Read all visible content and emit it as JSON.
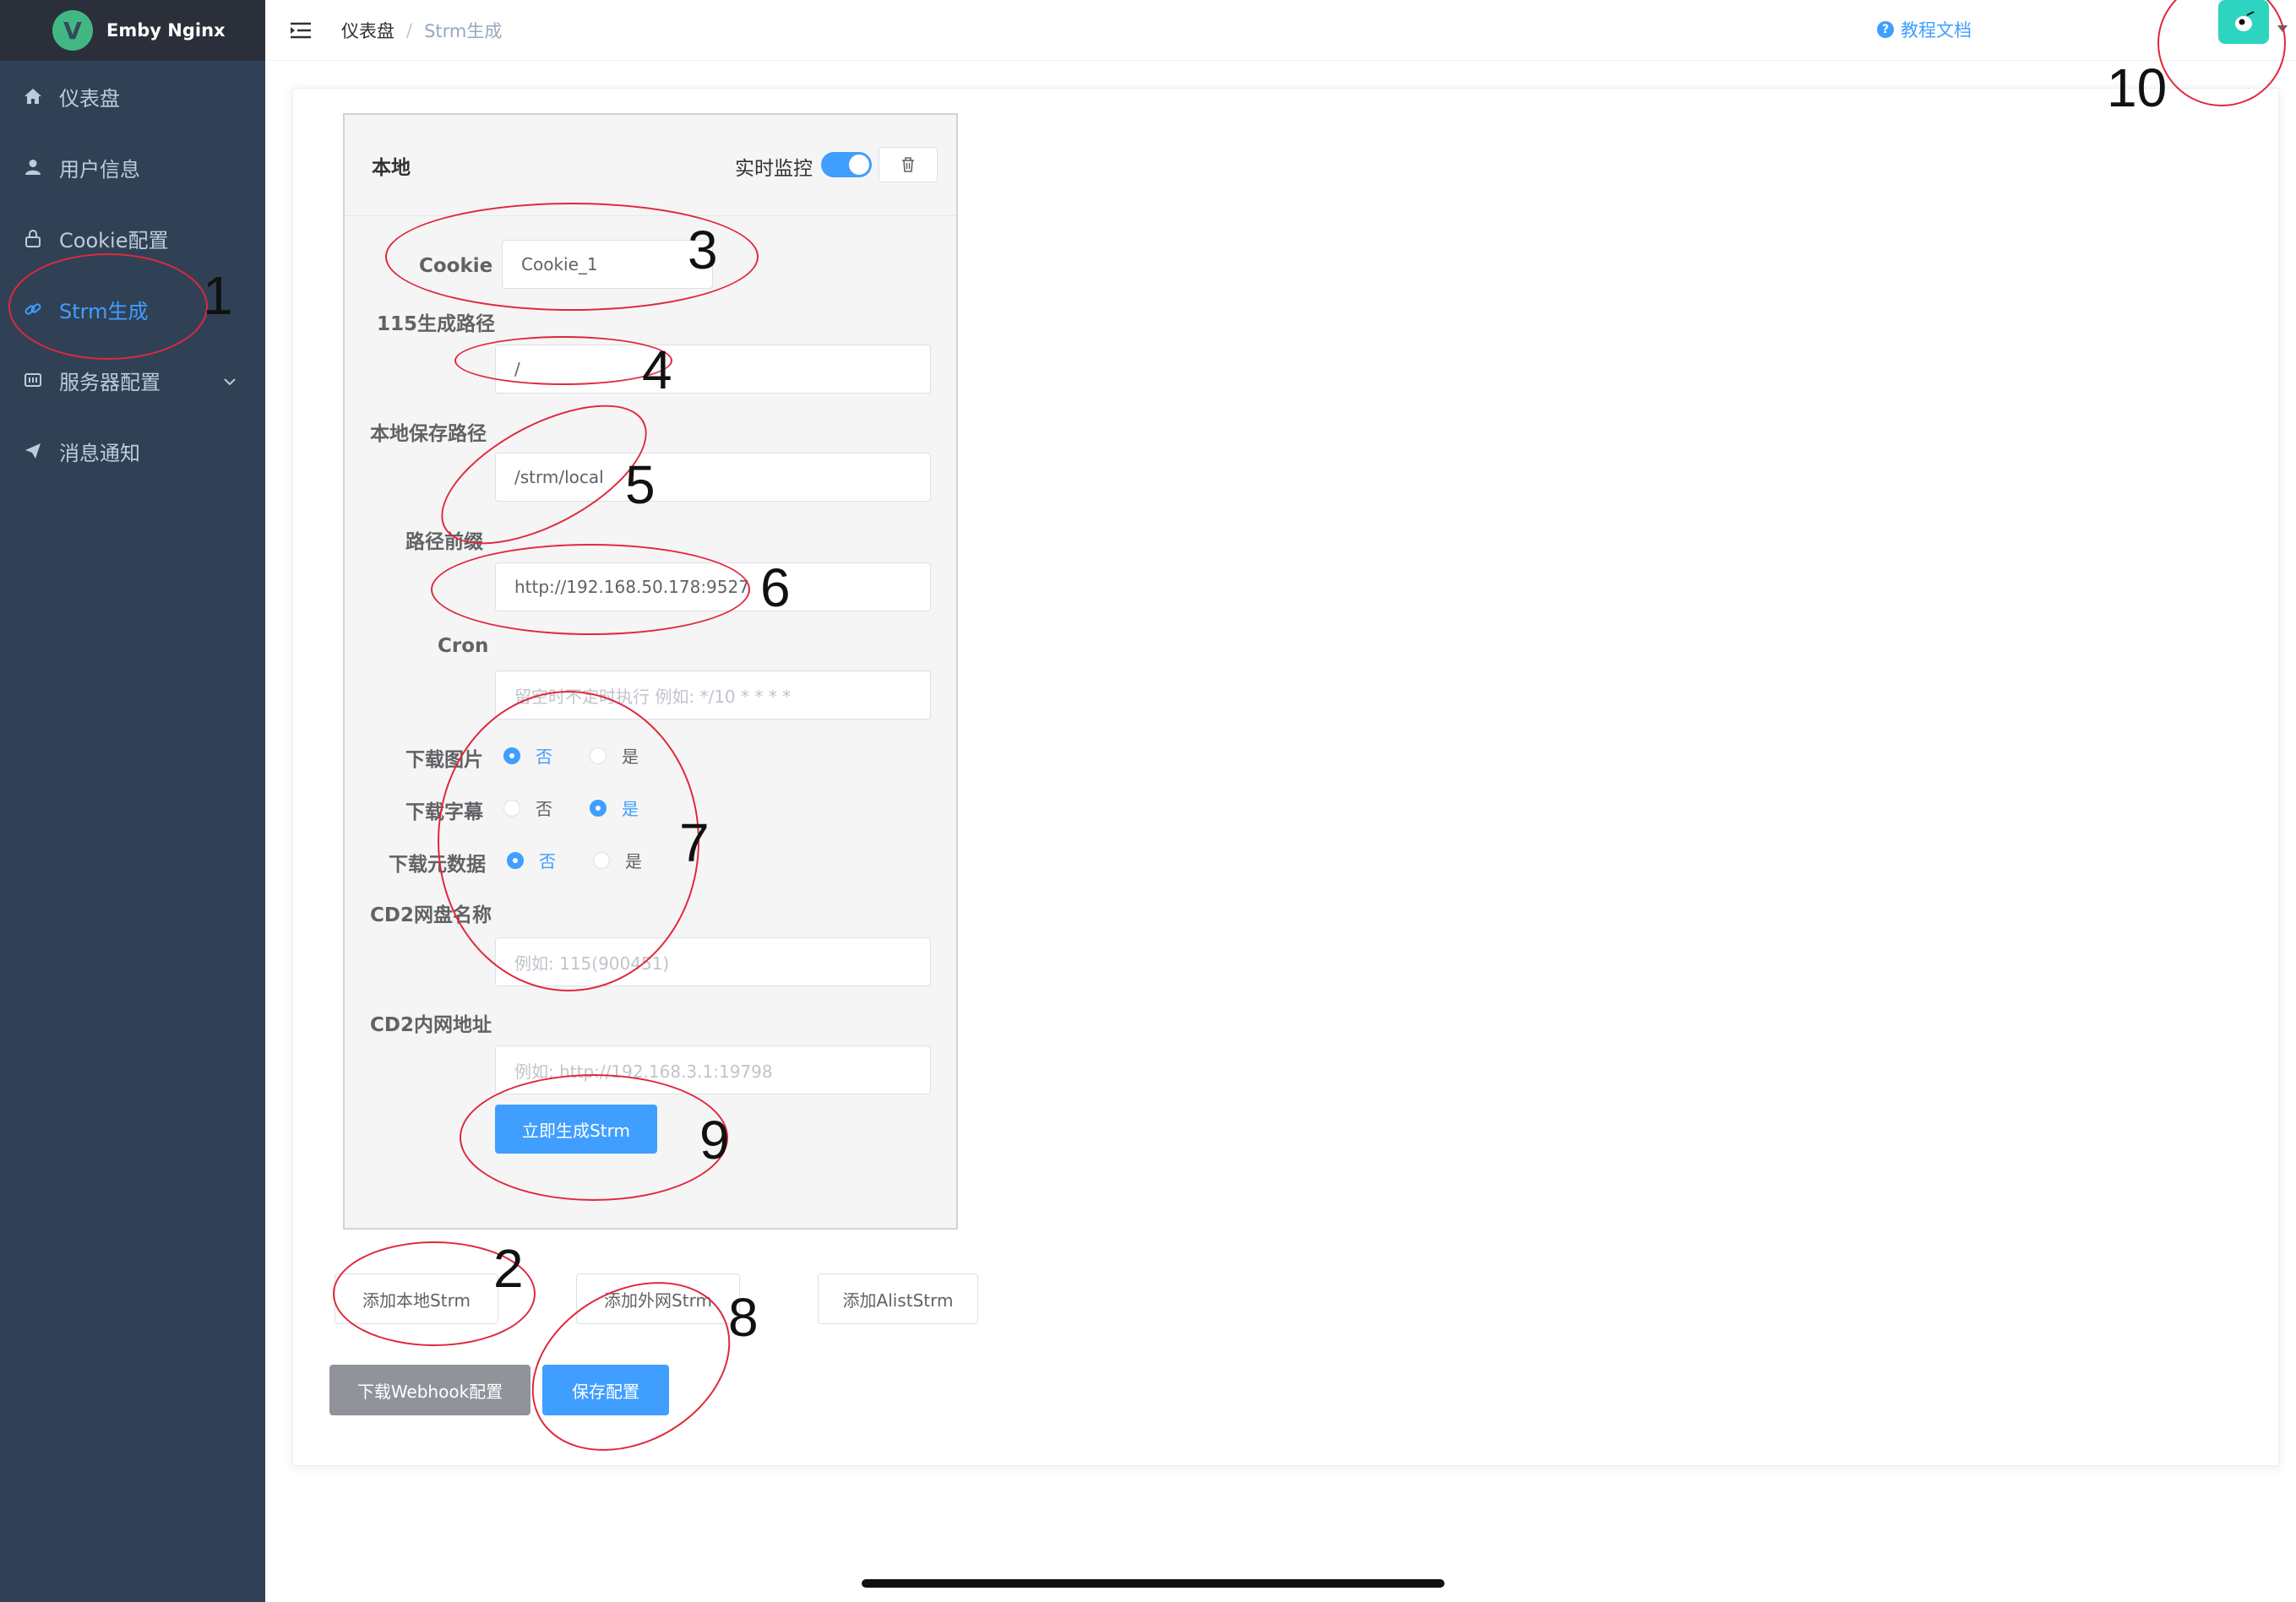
{
  "app": {
    "name": "Emby Nginx",
    "logo_letter": "V"
  },
  "sidebar": {
    "items": [
      {
        "label": "仪表盘",
        "icon": "home-icon",
        "active": false
      },
      {
        "label": "用户信息",
        "icon": "user-icon",
        "active": false
      },
      {
        "label": "Cookie配置",
        "icon": "lock-icon",
        "active": false
      },
      {
        "label": "Strm生成",
        "icon": "link-icon",
        "active": true
      },
      {
        "label": "服务器配置",
        "icon": "server-icon",
        "active": false,
        "expandable": true
      },
      {
        "label": "消息通知",
        "icon": "send-icon",
        "active": false
      }
    ]
  },
  "header": {
    "breadcrumb": [
      "仪表盘",
      "Strm生成"
    ],
    "breadcrumb_sep": "/",
    "help_link": "教程文档"
  },
  "form": {
    "card_title": "本地",
    "monitor_label": "实时监控",
    "monitor_on": true,
    "cookie": {
      "label": "Cookie",
      "value": "Cookie_1"
    },
    "path115": {
      "label": "115生成路径",
      "value": "/"
    },
    "local_path": {
      "label": "本地保存路径",
      "value": "/strm/local"
    },
    "prefix": {
      "label": "路径前缀",
      "value": "http://192.168.50.178:9527"
    },
    "cron": {
      "label": "Cron",
      "placeholder": "留空时不定时执行 例如: */10 * * * *"
    },
    "download_images": {
      "label": "下载图片",
      "no": "否",
      "yes": "是",
      "selected": "否"
    },
    "download_subs": {
      "label": "下载字幕",
      "no": "否",
      "yes": "是",
      "selected": "是"
    },
    "download_meta": {
      "label": "下载元数据",
      "no": "否",
      "yes": "是",
      "selected": "否"
    },
    "cd2_name": {
      "label": "CD2网盘名称",
      "placeholder": "例如: 115(900451)"
    },
    "cd2_url": {
      "label": "CD2内网地址",
      "placeholder": "例如: http://192.168.3.1:19798"
    },
    "generate_button": "立即生成Strm"
  },
  "actions": {
    "add_local": "添加本地Strm",
    "add_external": "添加外网Strm",
    "add_alist": "添加AlistStrm",
    "download_webhook": "下载Webhook配置",
    "save": "保存配置"
  },
  "annotations": [
    "1",
    "2",
    "3",
    "4",
    "5",
    "6",
    "7",
    "8",
    "9",
    "10"
  ],
  "colors": {
    "accent": "#409eff",
    "sidebar": "#304156",
    "annotation": "#e0283c"
  }
}
